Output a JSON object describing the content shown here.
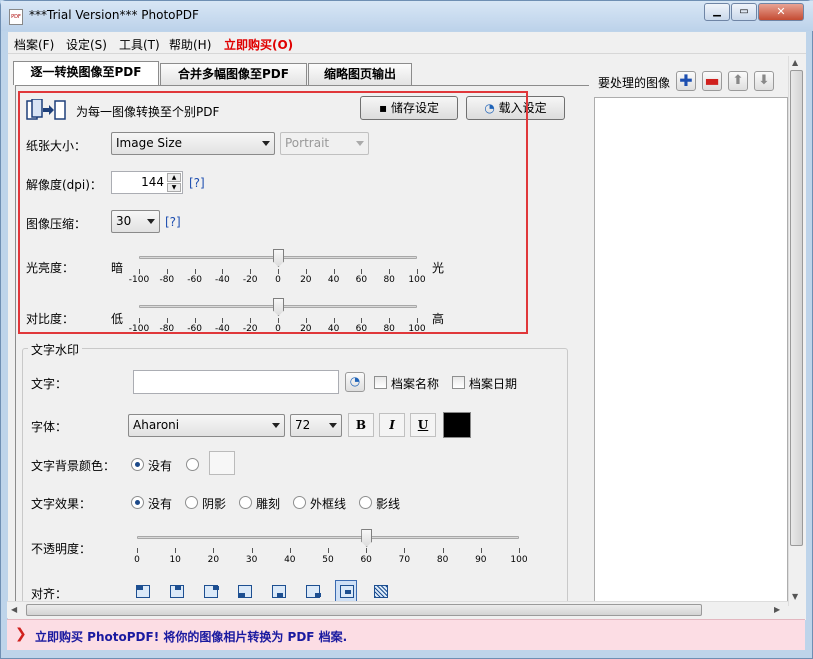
{
  "window": {
    "title": "***Trial Version*** PhotoPDF",
    "app_icon": "PDF"
  },
  "menu": {
    "items": [
      "档案(F)",
      "设定(S)",
      "工具(T)",
      "帮助(H)"
    ],
    "buy": "立即购买(O)",
    "buy_color": "#e00000"
  },
  "tabs": [
    "逐一转换图像至PDF",
    "合并多幅图像至PDF",
    "缩略图页输出"
  ],
  "top": {
    "desc": "为每一图像转换至个别PDF",
    "save_label": "储存设定",
    "load_label": "载入设定"
  },
  "paper": {
    "label": "纸张大小：",
    "size": "Image Size",
    "orientation": "Portrait"
  },
  "dpi": {
    "label": "解像度(dpi)：",
    "value": "144",
    "help": "[?]"
  },
  "compress": {
    "label": "图像压缩：",
    "value": "30",
    "help": "[?]"
  },
  "brightness": {
    "label": "光亮度：",
    "low": "暗",
    "high": "光",
    "value": 0,
    "ticks": [
      "-100",
      "-80",
      "-60",
      "-40",
      "-20",
      "0",
      "20",
      "40",
      "60",
      "80",
      "100"
    ]
  },
  "contrast": {
    "label": "对比度：",
    "low": "低",
    "high": "高",
    "value": 0,
    "ticks": [
      "-100",
      "-80",
      "-60",
      "-40",
      "-20",
      "0",
      "20",
      "40",
      "60",
      "80",
      "100"
    ]
  },
  "watermark": {
    "group": "文字水印",
    "text_label": "文字：",
    "text_value": "",
    "filename": "档案名称",
    "filedate": "档案日期",
    "font_label": "字体：",
    "font": "Aharoni",
    "size": "72",
    "bold": "B",
    "italic": "I",
    "underline": "U",
    "font_color": "#000000",
    "bg_label": "文字背景颜色：",
    "bg_none": "没有",
    "effect_label": "文字效果：",
    "effects": [
      "没有",
      "阴影",
      "雕刻",
      "外框线",
      "影线"
    ],
    "opacity_label": "不透明度：",
    "opacity": 60,
    "opacity_ticks": [
      "0",
      "10",
      "20",
      "30",
      "40",
      "50",
      "60",
      "70",
      "80",
      "90",
      "100"
    ],
    "align_label": "对齐："
  },
  "right": {
    "label": "要处理的图像"
  },
  "status": {
    "text": "立即购买 PhotoPDF! 将你的图像相片转换为 PDF 档案.",
    "color": "#1a1aa0"
  },
  "accent": "#e0373a"
}
